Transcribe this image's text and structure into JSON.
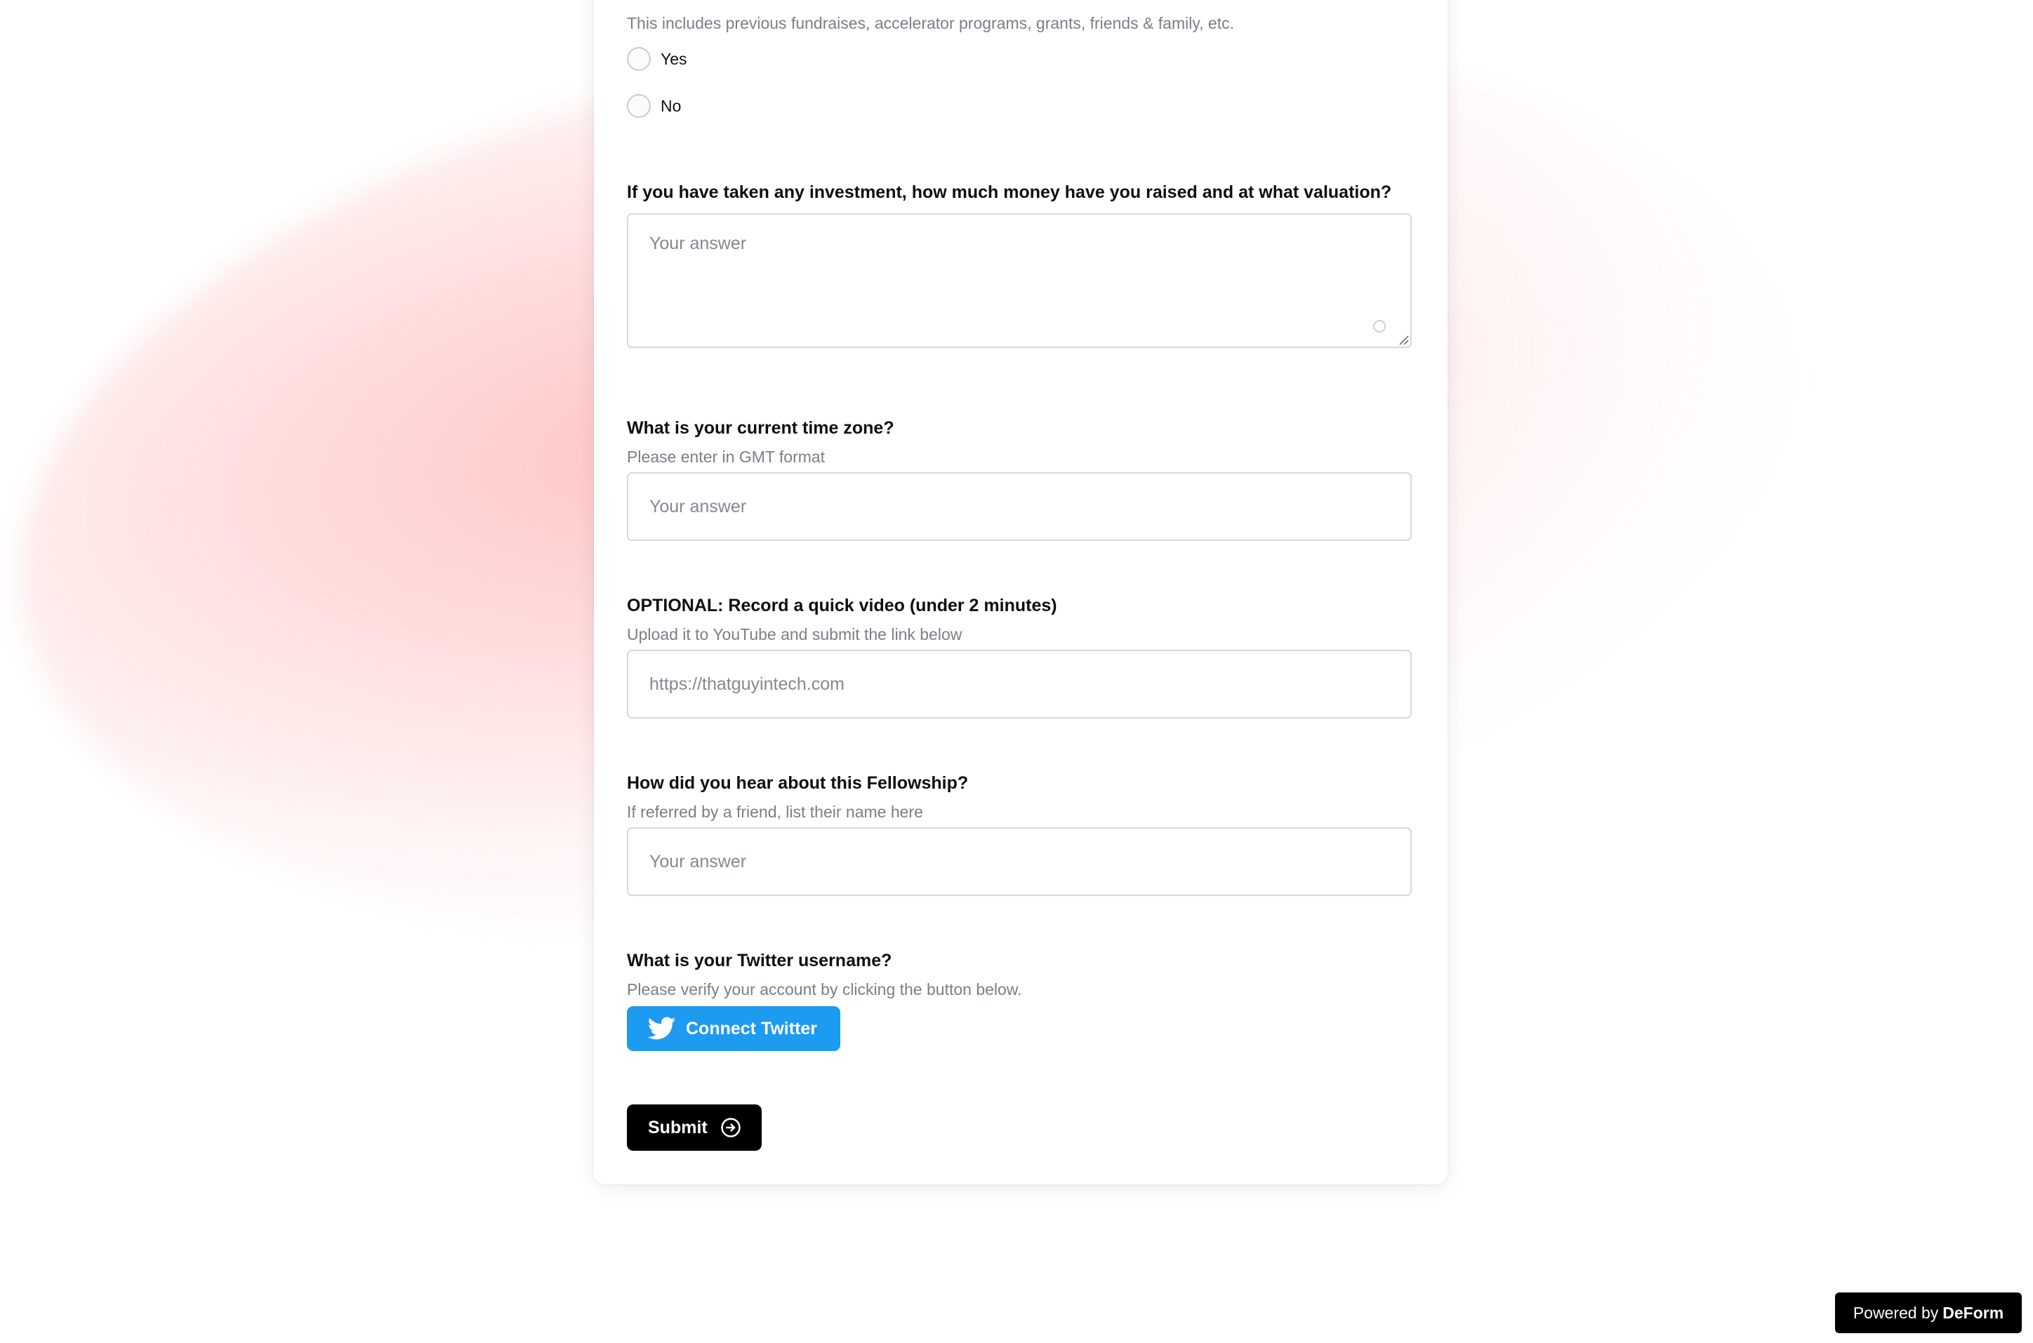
{
  "questions": {
    "investment": {
      "help": "This includes previous fundraises, accelerator programs, grants, friends & family, etc.",
      "options": [
        "Yes",
        "No"
      ]
    },
    "raised": {
      "title": "If you have taken any investment, how much money have you raised and at what valuation?",
      "placeholder": "Your answer"
    },
    "timezone": {
      "title": "What is your current time zone?",
      "help": "Please enter in GMT format",
      "placeholder": "Your answer"
    },
    "video": {
      "title": "OPTIONAL: Record a quick video (under 2 minutes)",
      "help": "Upload it to YouTube and submit the link below",
      "placeholder": "https://thatguyintech.com"
    },
    "referral": {
      "title": "How did you hear about this Fellowship?",
      "help": "If referred by a friend, list their name here",
      "placeholder": "Your answer"
    },
    "twitter": {
      "title": "What is your Twitter username?",
      "help": "Please verify your account by clicking the button below.",
      "button_label": "Connect Twitter"
    }
  },
  "submit_label": "Submit",
  "footer": {
    "powered_prefix": "Powered by",
    "brand": "DeForm"
  },
  "colors": {
    "twitter_blue": "#1d9bf0",
    "button_black": "#000000",
    "glow": "#ffb0b0"
  },
  "icons": {
    "twitter": "twitter-bird-icon",
    "submit": "arrow-right-circle-icon"
  }
}
